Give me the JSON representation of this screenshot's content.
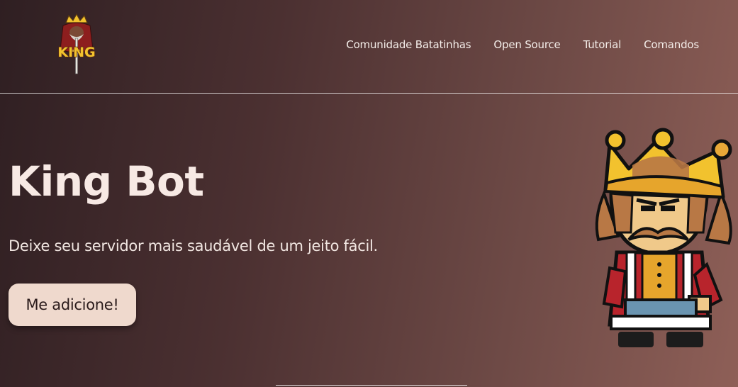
{
  "brand": {
    "logo_text": "KING"
  },
  "nav": {
    "links": [
      {
        "label": "Comunidade Batatinhas"
      },
      {
        "label": "Open Source"
      },
      {
        "label": "Tutorial"
      },
      {
        "label": "Comandos"
      }
    ]
  },
  "hero": {
    "title": "King Bot",
    "subtitle": "Deixe seu servidor mais saudável de um jeito fácil.",
    "cta_label": "Me adicione!"
  },
  "colors": {
    "background_start": "#2f1f22",
    "background_end": "#8e5f57",
    "button_bg": "#efd9cd",
    "crown_gold": "#f2c22e"
  },
  "icons": {
    "logo": "king-logo-icon",
    "mascot": "king-mascot-illustration"
  }
}
